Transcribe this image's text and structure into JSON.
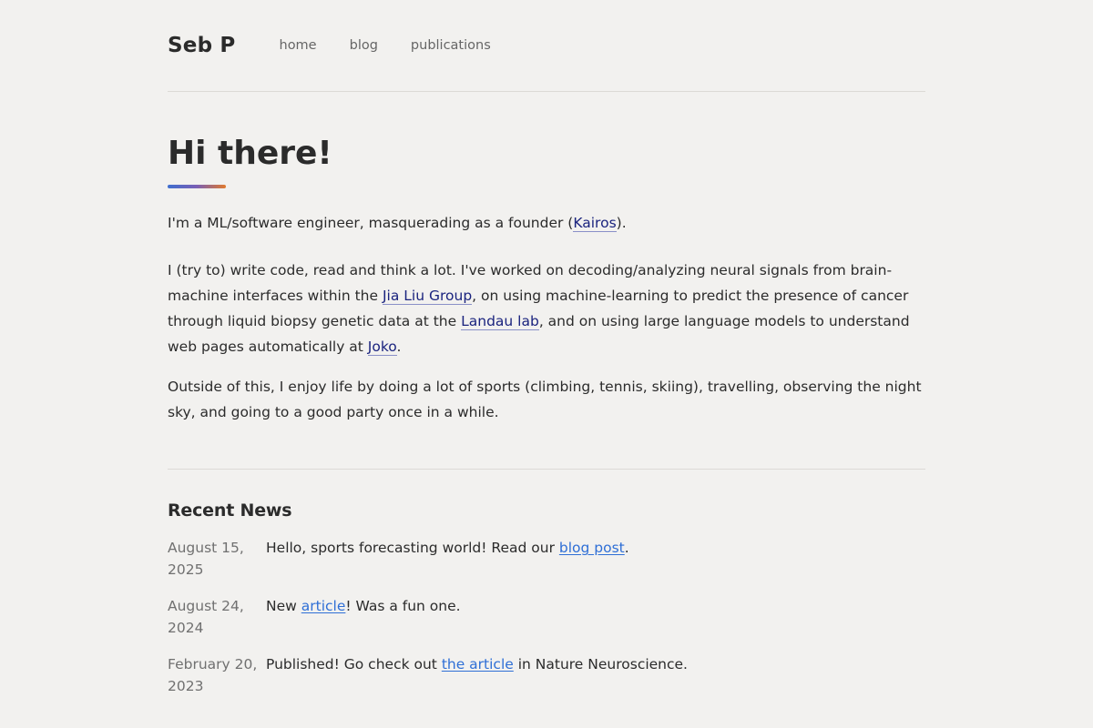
{
  "header": {
    "site_title": "Seb P",
    "nav": [
      {
        "label": "home"
      },
      {
        "label": "blog"
      },
      {
        "label": "publications"
      }
    ]
  },
  "hero": {
    "title": "Hi there!"
  },
  "intro": {
    "p1_before": "I'm a ML/software engineer, masquerading as a founder (",
    "p1_link": "Kairos",
    "p1_after": ").",
    "p2_a": "I (try to) write code, read and think a lot. I've worked on decoding/analyzing neural signals from brain-machine interfaces within the ",
    "p2_link1": "Jia Liu Group",
    "p2_b": ", on using machine-learning to predict the presence of cancer through liquid biopsy genetic data at the ",
    "p2_link2": "Landau lab",
    "p2_c": ", and on using large language models to understand web pages automatically at ",
    "p2_link3": "Joko",
    "p2_d": ".",
    "p3": "Outside of this, I enjoy life by doing a lot of sports (climbing, tennis, skiing), travelling, observing the night sky, and going to a good party once in a while."
  },
  "news": {
    "heading": "Recent News",
    "items": [
      {
        "date": "August 15, 2025",
        "before": "Hello, sports forecasting world! Read our ",
        "link": "blog post",
        "after": "."
      },
      {
        "date": "August 24, 2024",
        "before": "New ",
        "link": "article",
        "after": "! Was a fun one."
      },
      {
        "date": "February 20, 2023",
        "before": "Published! Go check out ",
        "link": "the article",
        "after": " in Nature Neuroscience."
      }
    ]
  },
  "colors": {
    "background": "#f2f1ef",
    "inline_link": "#1a237e",
    "news_link": "#2f6fd6"
  }
}
